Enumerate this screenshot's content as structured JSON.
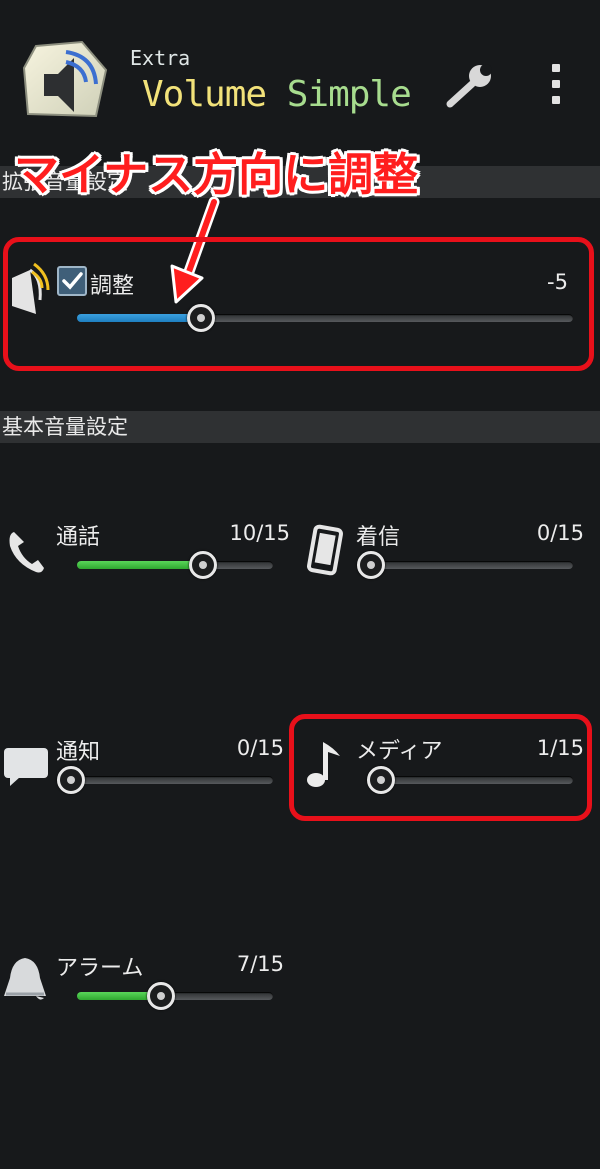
{
  "header": {
    "extra_label": "Extra",
    "title_word1": "Volume",
    "title_word2": "Simple",
    "app_icon": "speaker-app-icon",
    "settings_icon": "wrench-icon",
    "menu_icon": "overflow-menu-icon"
  },
  "annotation": {
    "text": "マイナス方向に調整",
    "color": "#ff1e1e"
  },
  "extended": {
    "section_title": "拡張音量設定",
    "label": "調整",
    "value": "-5",
    "checked": true,
    "fill_fraction": 0.25,
    "fill_color": "#1e7fc0"
  },
  "basic": {
    "section_title": "基本音量設定",
    "channels": [
      {
        "label": "通話",
        "value": "10/15",
        "level": 10,
        "max": 15,
        "icon": "phone-icon"
      },
      {
        "label": "着信",
        "value": "0/15",
        "level": 0,
        "max": 15,
        "icon": "mobile-phone-icon"
      },
      {
        "label": "通知",
        "value": "0/15",
        "level": 0,
        "max": 15,
        "icon": "speech-bubble-icon"
      },
      {
        "label": "メディア",
        "value": "1/15",
        "level": 1,
        "max": 15,
        "icon": "music-note-icon"
      },
      {
        "label": "アラーム",
        "value": "7/15",
        "level": 7,
        "max": 15,
        "icon": "bell-icon"
      }
    ],
    "fill_color": "#2fa830"
  }
}
